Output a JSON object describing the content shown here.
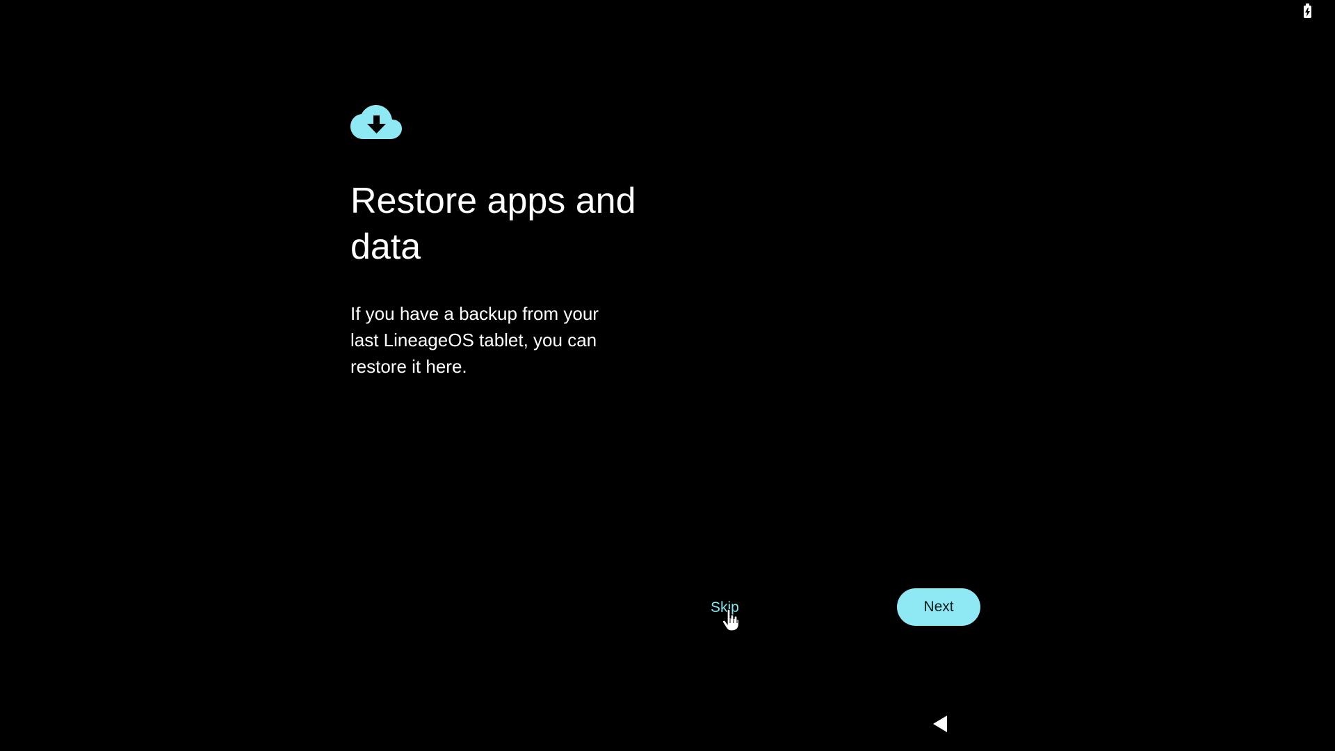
{
  "status_bar": {
    "battery_icon": "battery-charging-icon"
  },
  "setup": {
    "header_icon": "cloud-download-icon",
    "title": "Restore apps and data",
    "description": "If you have a backup from your last LineageOS tablet, you can restore it here.",
    "accent_color": "#8ee9f4"
  },
  "actions": {
    "skip_label": "Skip",
    "next_label": "Next"
  },
  "nav_bar": {
    "back_icon": "back-triangle-icon"
  }
}
